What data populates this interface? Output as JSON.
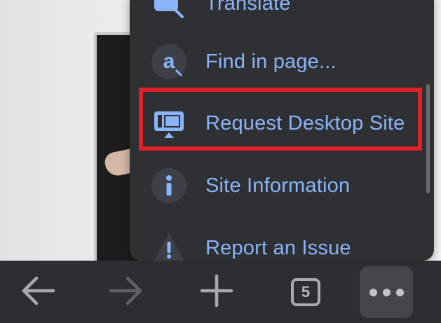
{
  "menu": {
    "items": [
      {
        "label": "Translate",
        "icon": "translate-icon"
      },
      {
        "label": "Find in page...",
        "icon": "find-in-page-icon"
      },
      {
        "label": "Request Desktop Site",
        "icon": "desktop-site-icon",
        "highlighted": true
      },
      {
        "label": "Site Information",
        "icon": "info-icon"
      },
      {
        "label": "Report an Issue",
        "icon": "warning-icon"
      }
    ],
    "label_color": "#8ab4f8",
    "highlight_color": "#e0202a"
  },
  "toolbar": {
    "back_icon": "back-arrow-icon",
    "forward_icon": "forward-arrow-icon",
    "new_tab_icon": "plus-icon",
    "tab_count": "5",
    "more_icon": "more-dots-icon"
  }
}
